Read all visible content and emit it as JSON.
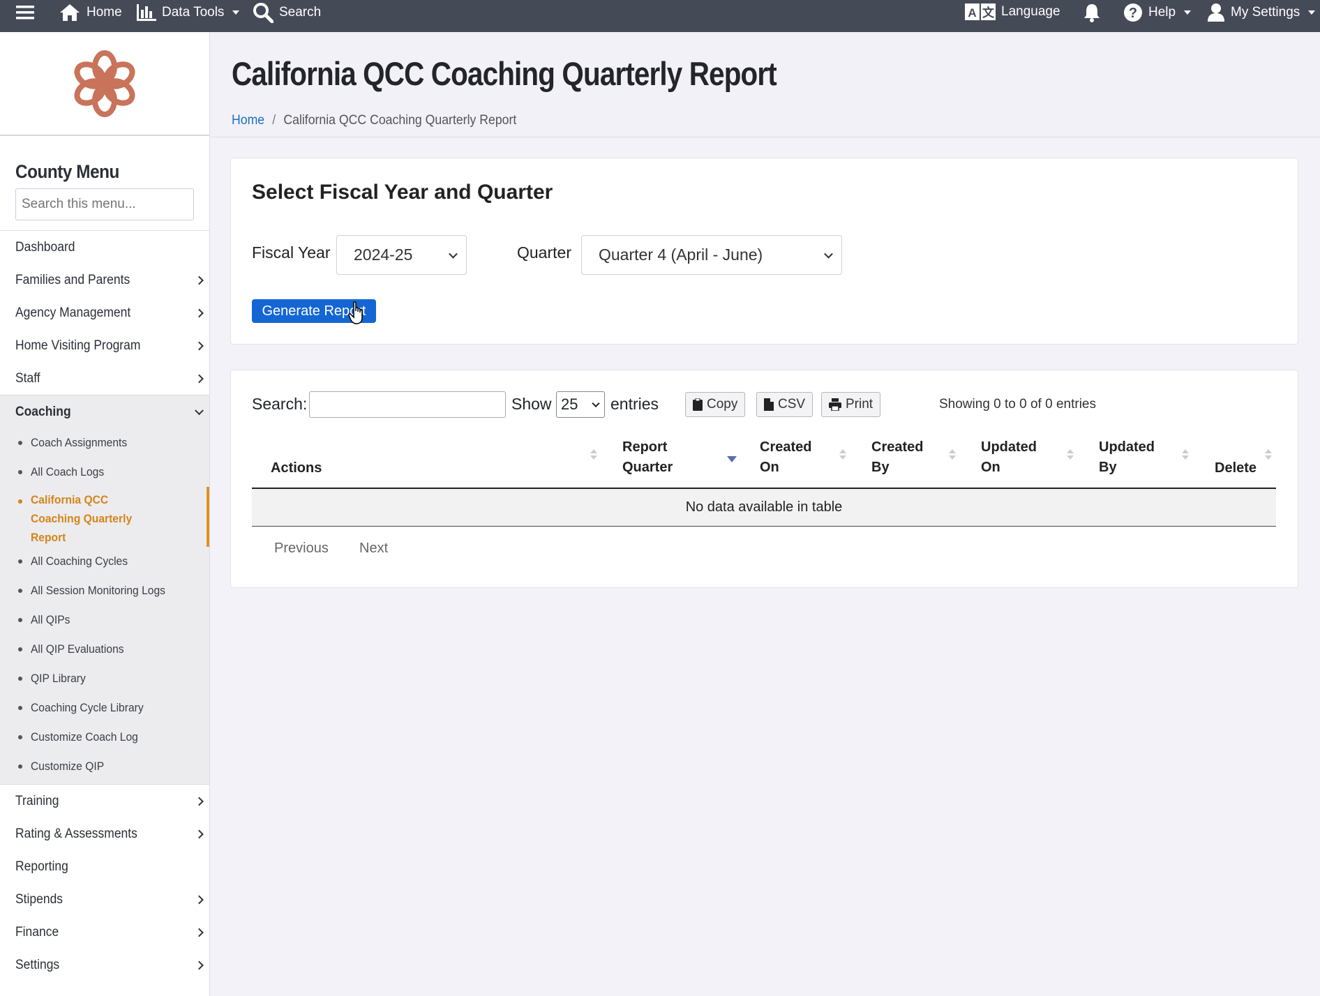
{
  "topbar": {
    "home": "Home",
    "data_tools": "Data Tools",
    "search": "Search",
    "language": "Language",
    "help": "Help",
    "my_settings": "My Settings"
  },
  "sidebar": {
    "title": "County Menu",
    "search_placeholder": "Search this menu...",
    "items_top": [
      {
        "label": "Dashboard",
        "expandable": false
      },
      {
        "label": "Families and Parents",
        "expandable": true
      },
      {
        "label": "Agency Management",
        "expandable": true
      },
      {
        "label": "Home Visiting Program",
        "expandable": true
      },
      {
        "label": "Staff",
        "expandable": true
      }
    ],
    "coaching": {
      "label": "Coaching",
      "subitems": [
        "Coach Assignments",
        "All Coach Logs",
        "California QCC Coaching Quarterly Report",
        "All Coaching Cycles",
        "All Session Monitoring Logs",
        "All QIPs",
        "All QIP Evaluations",
        "QIP Library",
        "Coaching Cycle Library",
        "Customize Coach Log",
        "Customize QIP"
      ],
      "active_index": 2
    },
    "items_bottom": [
      {
        "label": "Training",
        "expandable": true
      },
      {
        "label": "Rating & Assessments",
        "expandable": true
      },
      {
        "label": "Reporting",
        "expandable": false
      },
      {
        "label": "Stipends",
        "expandable": true
      },
      {
        "label": "Finance",
        "expandable": true
      },
      {
        "label": "Settings",
        "expandable": true
      }
    ]
  },
  "page": {
    "title": "California QCC Coaching Quarterly Report",
    "breadcrumb_home": "Home",
    "breadcrumb_sep": "/",
    "breadcrumb_current": "California QCC Coaching Quarterly Report"
  },
  "filters": {
    "heading": "Select Fiscal Year and Quarter",
    "fiscal_year_label": "Fiscal Year",
    "fiscal_year_value": "2024-25",
    "quarter_label": "Quarter",
    "quarter_value": "Quarter 4 (April - June)",
    "generate_label": "Generate Report"
  },
  "table": {
    "search_label": "Search:",
    "show_label": "Show",
    "page_length": "25",
    "entries_label": "entries",
    "copy_label": "Copy",
    "csv_label": "CSV",
    "print_label": "Print",
    "info": "Showing 0 to 0 of 0 entries",
    "columns": [
      [
        "Actions"
      ],
      [
        "Report",
        "Quarter"
      ],
      [
        "Created",
        "On"
      ],
      [
        "Created",
        "By"
      ],
      [
        "Updated",
        "On"
      ],
      [
        "Updated",
        "By"
      ],
      [
        "Delete"
      ]
    ],
    "empty_text": "No data available in table",
    "previous": "Previous",
    "next": "Next"
  },
  "colors": {
    "topbar": "#454a57",
    "accent": "#1466d4",
    "active_menu": "#d4851a",
    "logo": "#c8735a"
  }
}
